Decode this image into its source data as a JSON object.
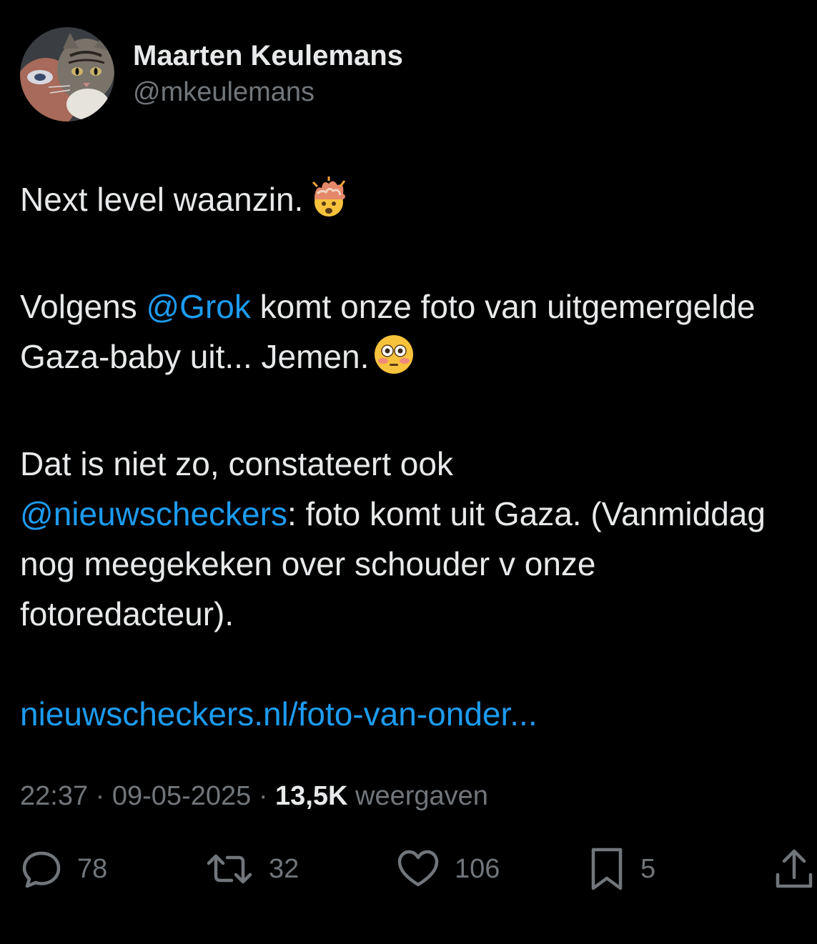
{
  "author": {
    "display_name": "Maarten Keulemans",
    "handle": "@mkeulemans",
    "avatar_icon": "cat-and-person-photo-avatar"
  },
  "tweet": {
    "line1": "Next level waanzin.",
    "line1_emoji": "exploding-head-emoji",
    "p2_before": "Volgens ",
    "p2_mention": "@Grok",
    "p2_after": " komt onze foto van uitgemergelde Gaza-baby uit... Jemen.",
    "p2_emoji": "flushed-face-emoji",
    "p3_before": "Dat is niet zo, constateert ook ",
    "p3_mention": "@nieuwscheckers",
    "p3_after": ": foto komt uit Gaza. (Vanmiddag nog meegekeken over schouder v onze fotoredacteur).",
    "link": "nieuwscheckers.nl/foto-van-onder..."
  },
  "meta": {
    "time": "22:37",
    "separator": " · ",
    "date": "09-05-2025",
    "views_count": "13,5K",
    "views_label": " weergaven"
  },
  "actions": {
    "replies": "78",
    "reposts": "32",
    "likes": "106",
    "bookmarks": "5",
    "reply_icon": "speech-bubble-icon",
    "repost_icon": "repost-arrows-icon",
    "like_icon": "heart-icon",
    "bookmark_icon": "bookmark-icon",
    "share_icon": "share-upload-icon"
  },
  "colors": {
    "background": "#000000",
    "text": "#e7e9ea",
    "secondary": "#71767b",
    "accent": "#1d9bf0"
  }
}
